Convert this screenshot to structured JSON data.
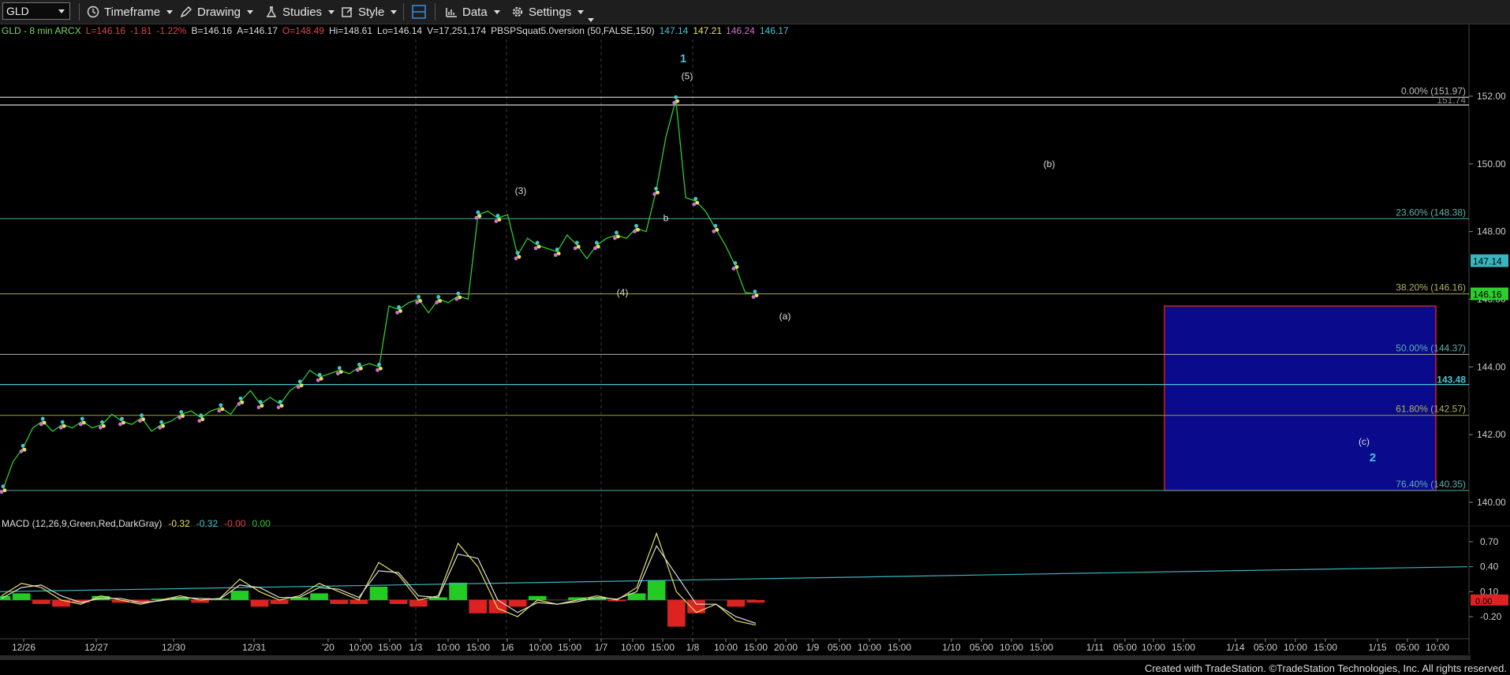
{
  "toolbar": {
    "symbol": "GLD",
    "timeframe": "Timeframe",
    "drawing": "Drawing",
    "studies": "Studies",
    "style": "Style",
    "data": "Data",
    "settings": "Settings"
  },
  "info": {
    "segments": [
      {
        "text": "GLD - 8 min  ARCX",
        "color": "#7fd36a"
      },
      {
        "text": "L=146.16",
        "color": "#e04444"
      },
      {
        "text": "-1.81",
        "color": "#e04444"
      },
      {
        "text": "-1.22%",
        "color": "#e04444"
      },
      {
        "text": "B=146.16",
        "color": "#dddddd"
      },
      {
        "text": "A=146.17",
        "color": "#dddddd"
      },
      {
        "text": "O=148.49",
        "color": "#e04444"
      },
      {
        "text": "Hi=148.61",
        "color": "#dddddd"
      },
      {
        "text": "Lo=146.14",
        "color": "#dddddd"
      },
      {
        "text": "V=17,251,174",
        "color": "#dddddd"
      },
      {
        "text": "PBSPSquat5.0version (50,FALSE,150)",
        "color": "#dddddd"
      },
      {
        "text": "147.14",
        "color": "#44c7d4"
      },
      {
        "text": "147.21",
        "color": "#e8e060"
      },
      {
        "text": "146.24",
        "color": "#d070d0"
      },
      {
        "text": "146.17",
        "color": "#44c7d4"
      }
    ]
  },
  "macd_info": {
    "segments": [
      {
        "text": "MACD (12,26,9,Green,Red,DarkGray)",
        "color": "#dddddd"
      },
      {
        "text": "-0.32",
        "color": "#e8e060"
      },
      {
        "text": "-0.32",
        "color": "#44c7d4"
      },
      {
        "text": "-0.00",
        "color": "#e04444"
      },
      {
        "text": "0.00",
        "color": "#2ec82e"
      }
    ]
  },
  "credit": "Created with TradeStation. ©TradeStation Technologies, Inc. All rights reserved.",
  "colors": {
    "price_up": "#2ecc2e",
    "cyan": "#44c7d4",
    "yellow": "#e8e060",
    "magenta": "#d070d0",
    "fib_target_box": "#0a0a8c",
    "fib_target_border": "#cc2222"
  },
  "chart_data": [
    {
      "type": "line",
      "panel": "price",
      "symbol": "GLD",
      "interval": "8 min",
      "ylim": [
        139.5,
        153.0
      ],
      "yticks": [
        140.0,
        142.0,
        144.0,
        146.0,
        148.0,
        150.0,
        152.0
      ],
      "ytick_labels": [
        "140.00",
        "142.00",
        "144.00",
        "146.00",
        "148.00",
        "150.00",
        "152.00"
      ],
      "grid": false,
      "last_price": 146.16,
      "last_price_label": "146.16",
      "cyan_price_label": "147.14",
      "series": [
        {
          "values": [
            140.4,
            141.2,
            141.6,
            142.2,
            142.4,
            142.1,
            142.3,
            142.2,
            142.4,
            142.2,
            142.3,
            142.6,
            142.4,
            142.3,
            142.5,
            142.1,
            142.3,
            142.4,
            142.6,
            142.7,
            142.5,
            142.7,
            142.8,
            142.6,
            143.0,
            143.3,
            142.9,
            143.1,
            142.9,
            143.3,
            143.5,
            143.9,
            143.7,
            143.8,
            143.9,
            143.8,
            144.0,
            144.1,
            144.0,
            145.8,
            145.7,
            145.9,
            146.0,
            145.6,
            146.0,
            145.9,
            146.1,
            146.0,
            148.5,
            148.6,
            148.4,
            148.5,
            147.3,
            147.8,
            147.6,
            147.5,
            147.4,
            147.9,
            147.6,
            147.2,
            147.6,
            147.8,
            147.9,
            147.8,
            148.1,
            148.0,
            149.2,
            150.8,
            151.9,
            149.0,
            148.9,
            148.6,
            148.1,
            147.6,
            147.0,
            146.2,
            146.16
          ]
        }
      ],
      "fib_levels": [
        {
          "pct": "0.00%",
          "value": 151.97,
          "label": "0.00% (151.97)",
          "color": "#d8d8d8"
        },
        {
          "value": 151.74,
          "label": "151.74",
          "color": "#d8d8d8"
        },
        {
          "pct": "23.60%",
          "value": 148.38,
          "label": "23.60% (148.38)",
          "color": "#3a8a88"
        },
        {
          "pct": "38.20%",
          "value": 146.16,
          "label": "38.20% (146.16)",
          "color": "#8c8c3a"
        },
        {
          "pct": "50.00%",
          "value": 144.37,
          "label": "50.00% (144.37)",
          "color": "#9c9c9c"
        },
        {
          "value": 143.48,
          "label": "143.48",
          "color": "#44c7d4"
        },
        {
          "pct": "61.80%",
          "value": 142.57,
          "label": "61.80% (142.57)",
          "color": "#8c8c3a"
        },
        {
          "pct": "76.40%",
          "value": 140.35,
          "label": "76.40% (140.35)",
          "color": "#3a8a88"
        }
      ],
      "target_box": {
        "top": 145.8,
        "bottom": 140.35
      },
      "wave_labels": [
        {
          "text": "1",
          "value": 153.1,
          "color": "#44c7d4"
        },
        {
          "text": "(5)",
          "value": 152.6,
          "color": "#dddddd"
        },
        {
          "text": "(3)",
          "value": 149.2,
          "color": "#dddddd"
        },
        {
          "text": "b",
          "value": 148.4,
          "color": "#dddddd"
        },
        {
          "text": "(4)",
          "value": 146.2,
          "color": "#dddddd"
        },
        {
          "text": "(a)",
          "value": 145.5,
          "color": "#dddddd"
        },
        {
          "text": "(b)",
          "value": 150.0,
          "color": "#dddddd"
        },
        {
          "text": "(c)",
          "value": 141.8,
          "color": "#dddddd"
        },
        {
          "text": "2",
          "value": 141.3,
          "color": "#44c7d4"
        }
      ]
    },
    {
      "type": "line",
      "panel": "macd",
      "ylim": [
        -0.3,
        0.83
      ],
      "yticks": [
        -0.2,
        0.1,
        0.4,
        0.7
      ],
      "ytick_labels": [
        "-0.20",
        "0.10",
        "0.40",
        "0.70"
      ],
      "zero_label": "0.00",
      "series": [
        {
          "name": "MACD",
          "color": "#e8e060",
          "values": [
            0.05,
            0.2,
            0.15,
            0.0,
            -0.05,
            0.05,
            0.0,
            -0.05,
            0.0,
            0.05,
            0.0,
            0.02,
            0.25,
            0.1,
            0.0,
            0.05,
            0.2,
            0.1,
            0.0,
            0.45,
            0.3,
            0.0,
            0.05,
            0.68,
            0.4,
            -0.1,
            -0.2,
            0.0,
            -0.05,
            0.0,
            0.05,
            0.0,
            0.15,
            0.8,
            0.1,
            -0.15,
            -0.05,
            -0.25,
            -0.3
          ]
        },
        {
          "name": "Avg",
          "color": "#dddddd",
          "values": [
            0.02,
            0.15,
            0.18,
            0.05,
            -0.03,
            0.02,
            0.02,
            -0.03,
            -0.01,
            0.03,
            0.02,
            0.01,
            0.18,
            0.15,
            0.03,
            0.03,
            0.15,
            0.13,
            0.03,
            0.35,
            0.33,
            0.05,
            0.03,
            0.55,
            0.5,
            0.0,
            -0.15,
            -0.03,
            -0.05,
            -0.02,
            0.03,
            0.01,
            0.1,
            0.65,
            0.3,
            -0.05,
            -0.05,
            -0.2,
            -0.28
          ]
        }
      ],
      "trendline": {
        "start": 0.1,
        "end": 0.4
      }
    }
  ],
  "x_axis": {
    "labels": [
      "12/26",
      "12/27",
      "12/30",
      "12/31",
      "'20",
      "10:00",
      "15:00",
      "1/3",
      "10:00",
      "15:00",
      "1/6",
      "10:00",
      "15:00",
      "1/7",
      "10:00",
      "15:00",
      "1/8",
      "10:00",
      "15:00",
      "20:00",
      "1/9",
      "05:00",
      "10:00",
      "15:00",
      "1/10",
      "05:00",
      "10:00",
      "15:00",
      "1/11",
      "05:00",
      "10:00",
      "15:00",
      "1/14",
      "05:00",
      "10:00",
      "15:00",
      "1/15",
      "05:00",
      "10:00"
    ]
  }
}
